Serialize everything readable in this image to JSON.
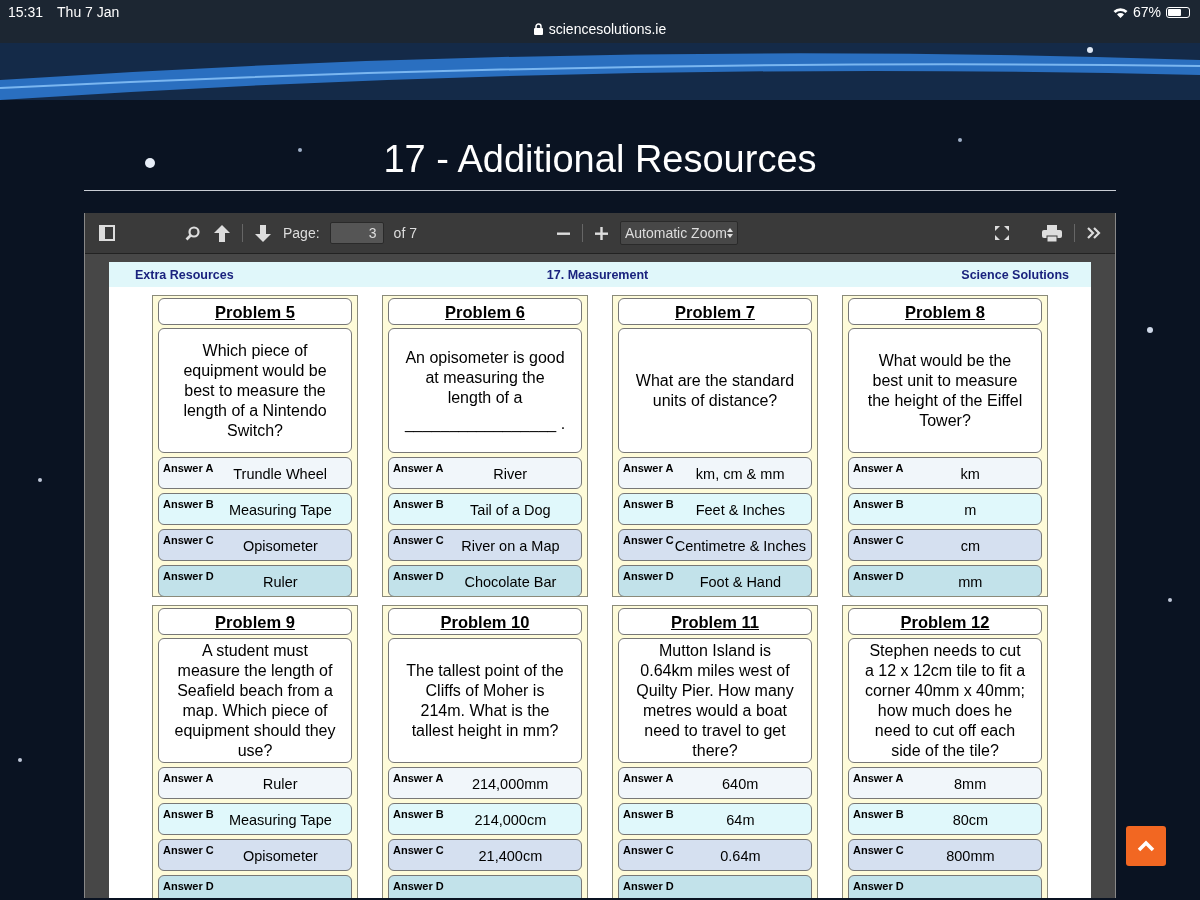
{
  "status_bar": {
    "time": "15:31",
    "date": "Thu 7 Jan",
    "battery": "67%",
    "url": "sciencesolutions.ie"
  },
  "page": {
    "title": "17 - Additional Resources"
  },
  "pdf_toolbar": {
    "page_label": "Page:",
    "page_value": "3",
    "page_count": "of 7",
    "zoom": "Automatic Zoom"
  },
  "document": {
    "header_left": "Extra Resources",
    "header_center": "17. Measurement",
    "header_right": "Science Solutions",
    "problems": [
      {
        "title": "Problem 5",
        "question": "Which piece of equipment would be best to measure the length of a Nintendo Switch?",
        "answers": [
          {
            "label": "Answer A",
            "text": "Trundle Wheel"
          },
          {
            "label": "Answer B",
            "text": "Measuring Tape"
          },
          {
            "label": "Answer C",
            "text": "Opisometer"
          },
          {
            "label": "Answer D",
            "text": "Ruler"
          }
        ]
      },
      {
        "title": "Problem 6",
        "question": "An opisometer is good at measuring the length of a",
        "blank": "_________________ .",
        "answers": [
          {
            "label": "Answer A",
            "text": "River"
          },
          {
            "label": "Answer B",
            "text": "Tail of a Dog"
          },
          {
            "label": "Answer C",
            "text": "River on a Map"
          },
          {
            "label": "Answer D",
            "text": "Chocolate Bar"
          }
        ]
      },
      {
        "title": "Problem 7",
        "question": "What are the standard units of distance?",
        "answers": [
          {
            "label": "Answer A",
            "text": "km, cm & mm"
          },
          {
            "label": "Answer B",
            "text": "Feet & Inches"
          },
          {
            "label": "Answer C",
            "text": "Centimetre & Inches"
          },
          {
            "label": "Answer D",
            "text": "Foot & Hand"
          }
        ]
      },
      {
        "title": "Problem 8",
        "question": "What would be the best unit to measure the height of the Eiffel Tower?",
        "answers": [
          {
            "label": "Answer A",
            "text": "km"
          },
          {
            "label": "Answer B",
            "text": "m"
          },
          {
            "label": "Answer C",
            "text": "cm"
          },
          {
            "label": "Answer D",
            "text": "mm"
          }
        ]
      },
      {
        "title": "Problem 9",
        "question": "A student must measure the length of Seafield beach from a map. Which piece of equipment should they use?",
        "answers": [
          {
            "label": "Answer A",
            "text": "Ruler"
          },
          {
            "label": "Answer B",
            "text": "Measuring Tape"
          },
          {
            "label": "Answer C",
            "text": "Opisometer"
          },
          {
            "label": "Answer D"
          }
        ]
      },
      {
        "title": "Problem 10",
        "question": "The tallest point of the Cliffs of Moher is 214m. What is the tallest height in mm?",
        "answers": [
          {
            "label": "Answer A",
            "text": "214,000mm"
          },
          {
            "label": "Answer B",
            "text": "214,000cm"
          },
          {
            "label": "Answer C",
            "text": "21,400cm"
          },
          {
            "label": "Answer D"
          }
        ]
      },
      {
        "title": "Problem 11",
        "question": "Mutton Island is 0.64km miles west of Quilty Pier. How many metres would a boat need to travel to get there?",
        "answers": [
          {
            "label": "Answer A",
            "text": "640m"
          },
          {
            "label": "Answer B",
            "text": "64m"
          },
          {
            "label": "Answer C",
            "text": "0.64m"
          },
          {
            "label": "Answer D"
          }
        ]
      },
      {
        "title": "Problem 12",
        "question": "Stephen needs to cut a 12 x 12cm tile to fit a corner 40mm x 40mm; how much does he need to cut off each side of the tile?",
        "answers": [
          {
            "label": "Answer A",
            "text": "8mm"
          },
          {
            "label": "Answer B",
            "text": "80cm"
          },
          {
            "label": "Answer C",
            "text": "800mm"
          },
          {
            "label": "Answer D"
          }
        ]
      }
    ]
  }
}
